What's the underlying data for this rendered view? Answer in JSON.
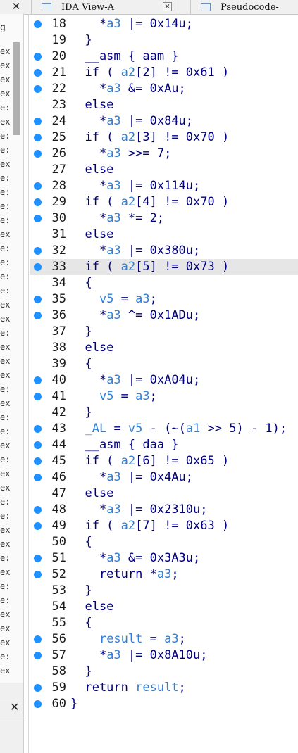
{
  "tabs": [
    {
      "label": "IDA View-A"
    },
    {
      "label": "Pseudocode-"
    }
  ],
  "left_panel": {
    "top_fragment": "g",
    "row_fragments": [
      "ex",
      "ex",
      "ex",
      "ex",
      "e:",
      "ex",
      "e:",
      "e:",
      "ex",
      "e:",
      "e:",
      "e:",
      "e:",
      "ex",
      "e:",
      "e:",
      "e:",
      "e:",
      "ex",
      "ex",
      "e:",
      "ex",
      "ex",
      "ex",
      "e:",
      "ex",
      "e:",
      "e:",
      "ex",
      "e:",
      "ex",
      "ex",
      "e:",
      "e:",
      "ex",
      "ex",
      "e:",
      "ex",
      "e:",
      "e:",
      "ex",
      "ex",
      "ex",
      "e:",
      "ex",
      "ex"
    ]
  },
  "editor": {
    "current_line": 33,
    "lines": [
      {
        "num": "18",
        "bp": true,
        "tokens": [
          {
            "t": "    *"
          },
          {
            "t": "a3",
            "c": "v"
          },
          {
            "t": " |= 0x14u;"
          }
        ]
      },
      {
        "num": "19",
        "bp": false,
        "tokens": [
          {
            "t": "  }"
          }
        ]
      },
      {
        "num": "20",
        "bp": true,
        "tokens": [
          {
            "t": "  __asm { aam }"
          }
        ]
      },
      {
        "num": "21",
        "bp": true,
        "tokens": [
          {
            "t": "  if ( "
          },
          {
            "t": "a2",
            "c": "v"
          },
          {
            "t": "[2] != 0x61 )"
          }
        ]
      },
      {
        "num": "22",
        "bp": true,
        "tokens": [
          {
            "t": "    *"
          },
          {
            "t": "a3",
            "c": "v"
          },
          {
            "t": " &= 0xAu;"
          }
        ]
      },
      {
        "num": "23",
        "bp": false,
        "tokens": [
          {
            "t": "  else"
          }
        ]
      },
      {
        "num": "24",
        "bp": true,
        "tokens": [
          {
            "t": "    *"
          },
          {
            "t": "a3",
            "c": "v"
          },
          {
            "t": " |= 0x84u;"
          }
        ]
      },
      {
        "num": "25",
        "bp": true,
        "tokens": [
          {
            "t": "  if ( "
          },
          {
            "t": "a2",
            "c": "v"
          },
          {
            "t": "[3] != 0x70 )"
          }
        ]
      },
      {
        "num": "26",
        "bp": true,
        "tokens": [
          {
            "t": "    *"
          },
          {
            "t": "a3",
            "c": "v"
          },
          {
            "t": " >>= 7;"
          }
        ]
      },
      {
        "num": "27",
        "bp": false,
        "tokens": [
          {
            "t": "  else"
          }
        ]
      },
      {
        "num": "28",
        "bp": true,
        "tokens": [
          {
            "t": "    *"
          },
          {
            "t": "a3",
            "c": "v"
          },
          {
            "t": " |= 0x114u;"
          }
        ]
      },
      {
        "num": "29",
        "bp": true,
        "tokens": [
          {
            "t": "  if ( "
          },
          {
            "t": "a2",
            "c": "v"
          },
          {
            "t": "[4] != 0x70 )"
          }
        ]
      },
      {
        "num": "30",
        "bp": true,
        "tokens": [
          {
            "t": "    *"
          },
          {
            "t": "a3",
            "c": "v"
          },
          {
            "t": " *= 2;"
          }
        ]
      },
      {
        "num": "31",
        "bp": false,
        "tokens": [
          {
            "t": "  else"
          }
        ]
      },
      {
        "num": "32",
        "bp": true,
        "tokens": [
          {
            "t": "    *"
          },
          {
            "t": "a3",
            "c": "v"
          },
          {
            "t": " |= 0x380u;"
          }
        ]
      },
      {
        "num": "33",
        "bp": true,
        "tokens": [
          {
            "t": "  if ( "
          },
          {
            "t": "a2",
            "c": "v"
          },
          {
            "t": "[5] != 0x73 )"
          }
        ]
      },
      {
        "num": "34",
        "bp": false,
        "tokens": [
          {
            "t": "  {"
          }
        ]
      },
      {
        "num": "35",
        "bp": true,
        "tokens": [
          {
            "t": "    "
          },
          {
            "t": "v5",
            "c": "v"
          },
          {
            "t": " = "
          },
          {
            "t": "a3",
            "c": "v"
          },
          {
            "t": ";"
          }
        ]
      },
      {
        "num": "36",
        "bp": true,
        "tokens": [
          {
            "t": "    *"
          },
          {
            "t": "a3",
            "c": "v"
          },
          {
            "t": " ^= 0x1ADu;"
          }
        ]
      },
      {
        "num": "37",
        "bp": false,
        "tokens": [
          {
            "t": "  }"
          }
        ]
      },
      {
        "num": "38",
        "bp": false,
        "tokens": [
          {
            "t": "  else"
          }
        ]
      },
      {
        "num": "39",
        "bp": false,
        "tokens": [
          {
            "t": "  {"
          }
        ]
      },
      {
        "num": "40",
        "bp": true,
        "tokens": [
          {
            "t": "    *"
          },
          {
            "t": "a3",
            "c": "v"
          },
          {
            "t": " |= 0xA04u;"
          }
        ]
      },
      {
        "num": "41",
        "bp": true,
        "tokens": [
          {
            "t": "    "
          },
          {
            "t": "v5",
            "c": "v"
          },
          {
            "t": " = "
          },
          {
            "t": "a3",
            "c": "v"
          },
          {
            "t": ";"
          }
        ]
      },
      {
        "num": "42",
        "bp": false,
        "tokens": [
          {
            "t": "  }"
          }
        ]
      },
      {
        "num": "43",
        "bp": true,
        "tokens": [
          {
            "t": "  "
          },
          {
            "t": "_AL",
            "c": "v"
          },
          {
            "t": " = "
          },
          {
            "t": "v5",
            "c": "v"
          },
          {
            "t": " - (~("
          },
          {
            "t": "a1",
            "c": "v"
          },
          {
            "t": " >> 5) - 1);"
          }
        ]
      },
      {
        "num": "44",
        "bp": true,
        "tokens": [
          {
            "t": "  __asm { daa }"
          }
        ]
      },
      {
        "num": "45",
        "bp": true,
        "tokens": [
          {
            "t": "  if ( "
          },
          {
            "t": "a2",
            "c": "v"
          },
          {
            "t": "[6] != 0x65 )"
          }
        ]
      },
      {
        "num": "46",
        "bp": true,
        "tokens": [
          {
            "t": "    *"
          },
          {
            "t": "a3",
            "c": "v"
          },
          {
            "t": " |= 0x4Au;"
          }
        ]
      },
      {
        "num": "47",
        "bp": false,
        "tokens": [
          {
            "t": "  else"
          }
        ]
      },
      {
        "num": "48",
        "bp": true,
        "tokens": [
          {
            "t": "    *"
          },
          {
            "t": "a3",
            "c": "v"
          },
          {
            "t": " |= 0x2310u;"
          }
        ]
      },
      {
        "num": "49",
        "bp": true,
        "tokens": [
          {
            "t": "  if ( "
          },
          {
            "t": "a2",
            "c": "v"
          },
          {
            "t": "[7] != 0x63 )"
          }
        ]
      },
      {
        "num": "50",
        "bp": false,
        "tokens": [
          {
            "t": "  {"
          }
        ]
      },
      {
        "num": "51",
        "bp": true,
        "tokens": [
          {
            "t": "    *"
          },
          {
            "t": "a3",
            "c": "v"
          },
          {
            "t": " &= 0x3A3u;"
          }
        ]
      },
      {
        "num": "52",
        "bp": true,
        "tokens": [
          {
            "t": "    return *"
          },
          {
            "t": "a3",
            "c": "v"
          },
          {
            "t": ";"
          }
        ]
      },
      {
        "num": "53",
        "bp": false,
        "tokens": [
          {
            "t": "  }"
          }
        ]
      },
      {
        "num": "54",
        "bp": false,
        "tokens": [
          {
            "t": "  else"
          }
        ]
      },
      {
        "num": "55",
        "bp": false,
        "tokens": [
          {
            "t": "  {"
          }
        ]
      },
      {
        "num": "56",
        "bp": true,
        "tokens": [
          {
            "t": "    "
          },
          {
            "t": "result",
            "c": "v"
          },
          {
            "t": " = "
          },
          {
            "t": "a3",
            "c": "v"
          },
          {
            "t": ";"
          }
        ]
      },
      {
        "num": "57",
        "bp": true,
        "tokens": [
          {
            "t": "    *"
          },
          {
            "t": "a3",
            "c": "v"
          },
          {
            "t": " |= 0x8A10u;"
          }
        ]
      },
      {
        "num": "58",
        "bp": false,
        "tokens": [
          {
            "t": "  }"
          }
        ]
      },
      {
        "num": "59",
        "bp": true,
        "tokens": [
          {
            "t": "  return "
          },
          {
            "t": "result",
            "c": "v"
          },
          {
            "t": ";"
          }
        ]
      },
      {
        "num": "60",
        "bp": true,
        "tokens": [
          {
            "t": "}"
          }
        ]
      }
    ]
  },
  "colors": {
    "breakpoint": "#1e90ff",
    "variable": "#2f7fd4",
    "code_text": "#000080",
    "current_line_bg": "#e6e6e6"
  }
}
